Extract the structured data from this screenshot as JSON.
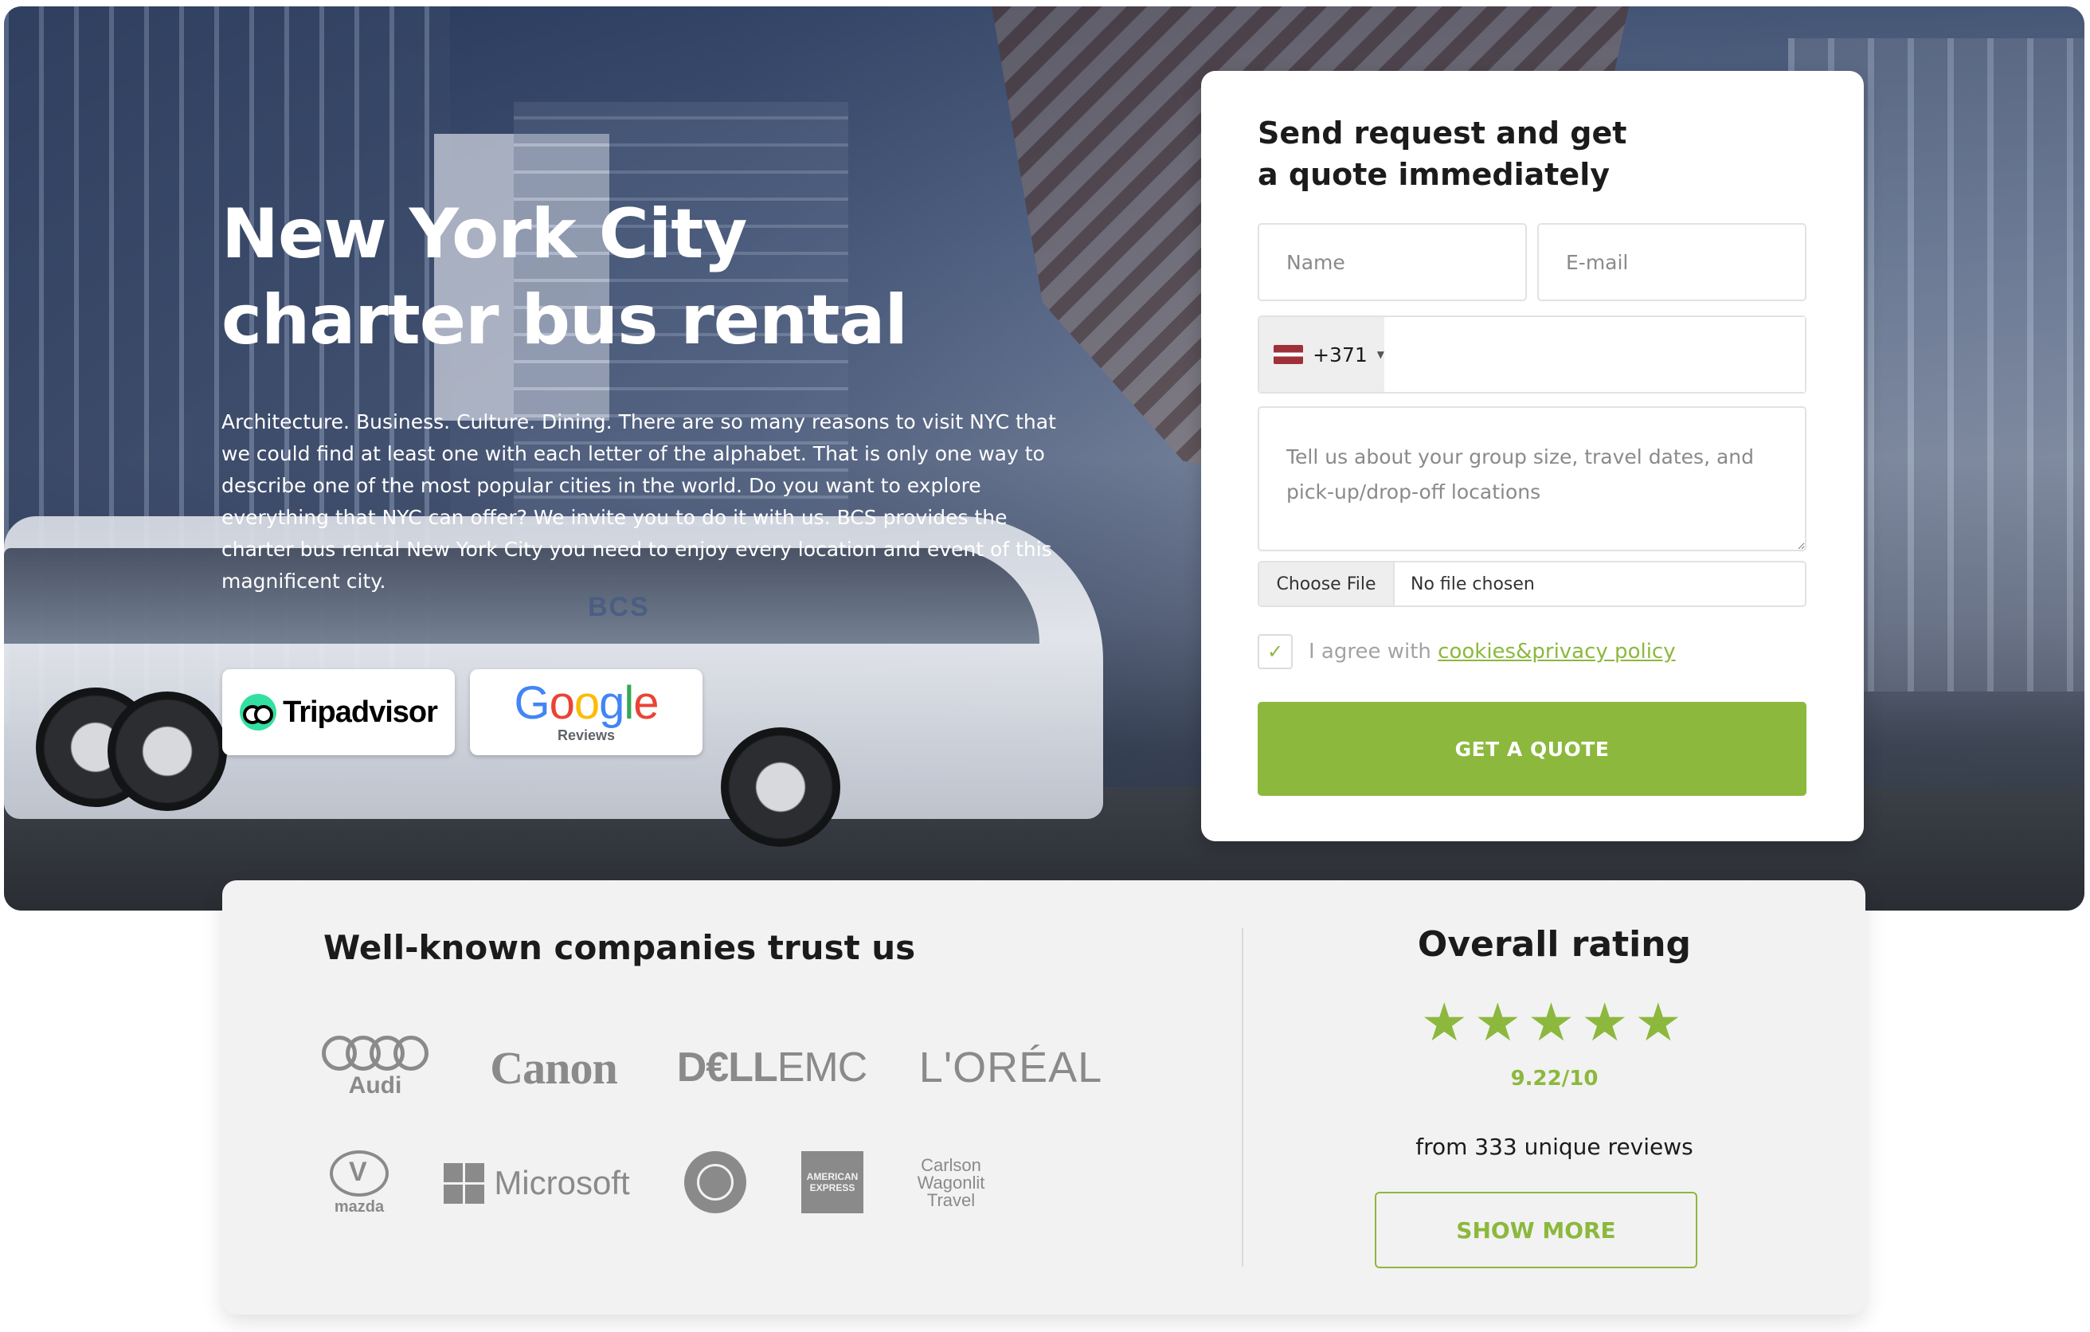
{
  "hero": {
    "title_line1": "New York City",
    "title_line2": "charter bus rental",
    "description": "Architecture. Business. Culture. Dining. There are so many reasons to visit NYC that we could find at least one with each letter of the alphabet. That is only one way to describe one of the most popular cities in the world. Do you want to explore everything that NYC can offer? We invite you to do it with us. BCS provides the charter bus rental New York City you need to enjoy every location and event of this magnificent city.",
    "bus_mark": "BCS",
    "badges": {
      "tripadvisor": "Tripadvisor",
      "google_word": [
        "G",
        "o",
        "o",
        "g",
        "l",
        "e"
      ],
      "google_sub": "Reviews",
      "google_stars": "★★★★★"
    },
    "accent_color": "#8cb83d"
  },
  "form": {
    "title_line1": "Send request and get",
    "title_line2": "a quote immediately",
    "name_placeholder": "Name",
    "email_placeholder": "E-mail",
    "phone_code": "+371",
    "message_placeholder": "Tell us about your group size, travel dates, and pick-up/drop-off locations",
    "file_button": "Choose File",
    "file_status": "No file chosen",
    "agree_prefix": "I agree with ",
    "agree_link": "cookies&privacy policy",
    "agree_checked": true,
    "check_mark": "✓",
    "submit_label": "GET A QUOTE"
  },
  "trust": {
    "title": "Well-known companies trust us",
    "logos": {
      "audi": "Audi",
      "canon": "Canon",
      "dell_bold": "D€LL",
      "dell_light": "EMC",
      "loreal": "L'ORÉAL",
      "mazda": "mazda",
      "microsoft": "Microsoft",
      "amex": "AMERICAN EXPRESS",
      "carlson": "Carlson Wagonlit Travel"
    }
  },
  "rating": {
    "title": "Overall rating",
    "stars": "★★★★★",
    "score": "9.22/10",
    "reviews": "from 333 unique reviews",
    "show_more": "SHOW MORE"
  }
}
